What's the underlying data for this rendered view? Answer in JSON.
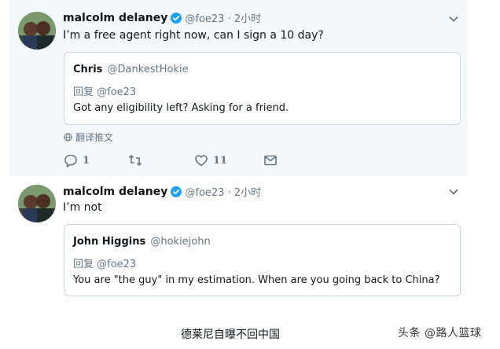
{
  "tweets": [
    {
      "author_name": "malcolm delaney",
      "author_handle": "@foe23 · 2小时",
      "text": "I’m a free agent right now, can I sign a 10 day?",
      "quote": {
        "name": "Chris",
        "handle": "@DankestHokie",
        "reply_label": "回复 @foe23",
        "text": "Got any eligibility left? Asking for a friend."
      },
      "translate_label": "翻译推文",
      "actions": {
        "reply_count": "1",
        "retweet_count": "",
        "like_count": "11"
      }
    },
    {
      "author_name": "malcolm delaney",
      "author_handle": "@foe23 · 2小时",
      "text": "I’m not",
      "quote": {
        "name": "John Higgins",
        "handle": "@hokiejohn",
        "reply_label": "回复 @foe23",
        "text": "You are \"the guy\" in my estimation.  When are you going back to China?"
      }
    }
  ],
  "caption": "德莱尼自曝不回中国",
  "watermark": "头条 @路人篮球",
  "colors": {
    "verified": "#1da1f2",
    "muted": "#657786",
    "border": "#ccd6dd",
    "highlight_bg": "#f5f8fa"
  },
  "icons": [
    "verified-badge-icon",
    "chevron-down-icon",
    "globe-icon",
    "reply-icon",
    "retweet-icon",
    "like-icon",
    "message-icon"
  ]
}
